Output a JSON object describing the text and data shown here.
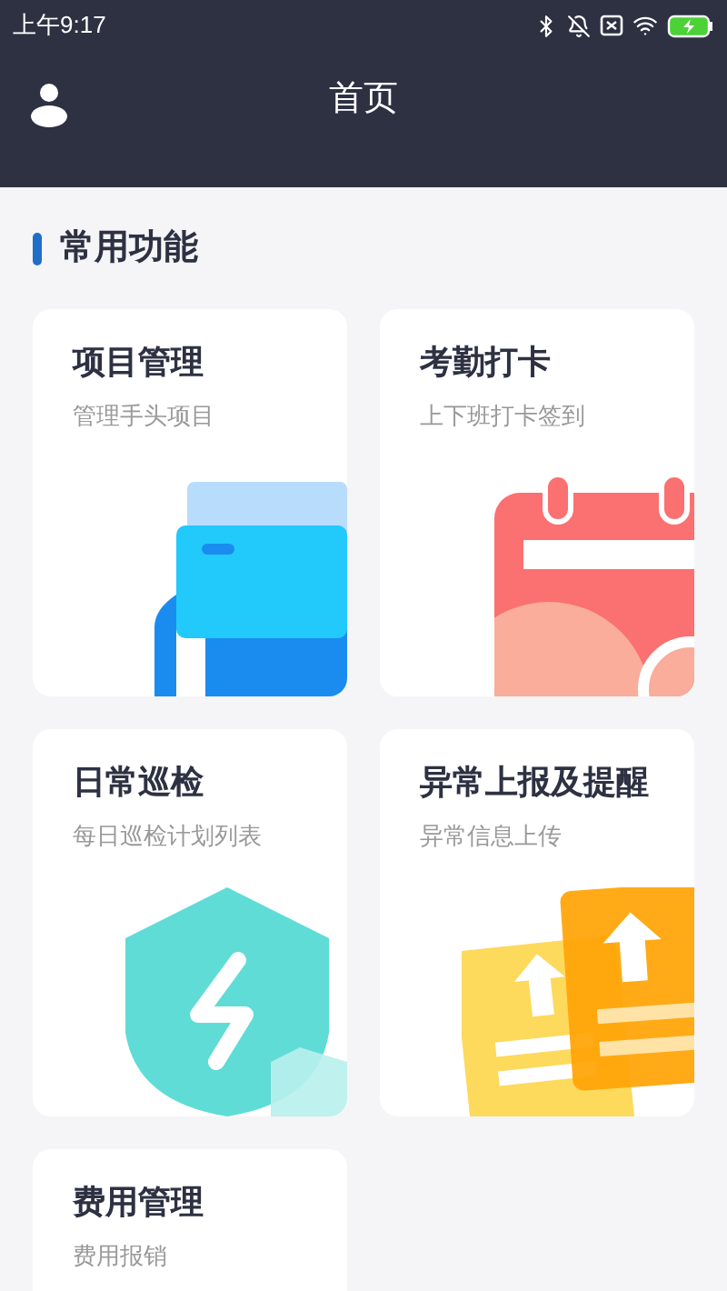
{
  "status_bar": {
    "time": "上午9:17"
  },
  "header": {
    "title": "首页"
  },
  "section": {
    "title": "常用功能"
  },
  "cards": [
    {
      "title": "项目管理",
      "subtitle": "管理手头项目",
      "kind": "folder"
    },
    {
      "title": "考勤打卡",
      "subtitle": "上下班打卡签到",
      "kind": "calendar"
    },
    {
      "title": "日常巡检",
      "subtitle": "每日巡检计划列表",
      "kind": "shield"
    },
    {
      "title": "异常上报及提醒",
      "subtitle": "异常信息上传",
      "kind": "upload"
    },
    {
      "title": "费用管理",
      "subtitle": "费用报销"
    }
  ]
}
